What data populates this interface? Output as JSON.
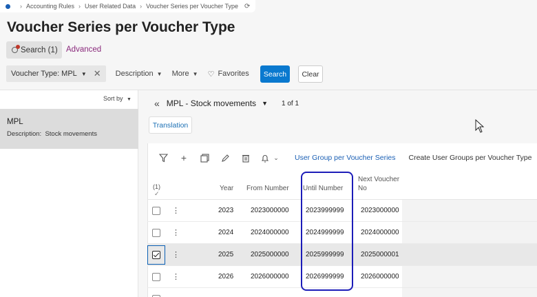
{
  "breadcrumb": {
    "items": [
      "Accounting Rules",
      "User Related Data",
      "Voucher Series per Voucher Type"
    ]
  },
  "page": {
    "title": "Voucher Series per Voucher Type"
  },
  "search": {
    "tab_label": "Search (1)",
    "advanced_label": "Advanced"
  },
  "filters": {
    "voucher_type": "Voucher Type: MPL",
    "description": "Description",
    "more": "More",
    "favorites": "Favorites",
    "search_button": "Search",
    "clear_button": "Clear"
  },
  "list": {
    "sort_label": "Sort by",
    "items": [
      {
        "name": "MPL",
        "description_label": "Description:",
        "description_value": "Stock movements"
      }
    ]
  },
  "record": {
    "title": "MPL - Stock movements",
    "count": "1 of 1",
    "translation_button": "Translation"
  },
  "toolbar": {
    "link_user_group": "User Group per Voucher Series",
    "create_groups": "Create User Groups per Voucher Type"
  },
  "table": {
    "selection_count": "(1)",
    "columns": [
      "Year",
      "From Number",
      "Until Number",
      "Next Voucher No"
    ],
    "next_col_line1": "Next Voucher",
    "next_col_line2": "No",
    "rows": [
      {
        "year": "2023",
        "from": "2023000000",
        "until": "2023999999",
        "next": "2023000000",
        "selected": false
      },
      {
        "year": "2024",
        "from": "2024000000",
        "until": "2024999999",
        "next": "2024000000",
        "selected": false
      },
      {
        "year": "2025",
        "from": "2025000000",
        "until": "2025999999",
        "next": "2025000001",
        "selected": true
      },
      {
        "year": "2026",
        "from": "2026000000",
        "until": "2026999999",
        "next": "2026000000",
        "selected": false
      }
    ]
  },
  "colors": {
    "primary": "#0a79cf",
    "link": "#1a5fb4",
    "advanced": "#8a2a7c",
    "highlight": "#1c1cb8"
  }
}
